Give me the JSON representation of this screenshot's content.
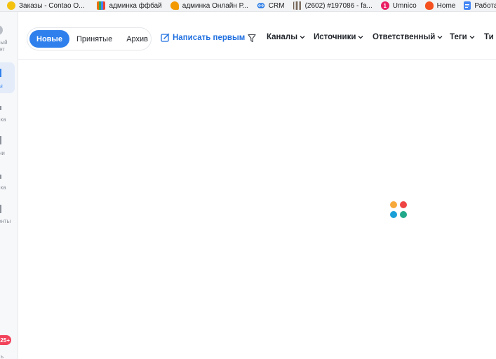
{
  "bookmarks": [
    {
      "label": "Заказы - Contao O...",
      "icon": "contao-icon",
      "color": "#f4b400"
    },
    {
      "label": "админка ффбай",
      "icon": "apps-grid-icon",
      "color": "#e8710a"
    },
    {
      "label": "админка Онлайн Р...",
      "icon": "pizza-icon",
      "color": "#f29900"
    },
    {
      "label": "CRM",
      "icon": "crm-link-icon",
      "color": "#1a73e8"
    },
    {
      "label": "(2602) #197086 - fa...",
      "icon": "barcode-icon",
      "color": "#7a6a5a"
    },
    {
      "label": "Umnico",
      "icon": "umnico-icon",
      "color": "#e91e63",
      "badge": "1"
    },
    {
      "label": "Home",
      "icon": "home-icon",
      "color": "#f4511e"
    },
    {
      "label": "Работа в б",
      "icon": "docs-icon",
      "color": "#4285f4"
    }
  ],
  "sidebar": {
    "profile_line1": "ный",
    "profile_line2": "ет",
    "items": [
      {
        "label": "ы"
      },
      {
        "label": "ика"
      },
      {
        "label": "ни"
      },
      {
        "label": "ика"
      },
      {
        "label": "енты"
      }
    ],
    "badge": "25+",
    "bottom_label": "ь"
  },
  "toolbar": {
    "tabs": [
      {
        "label": "Новые",
        "active": true
      },
      {
        "label": "Принятые",
        "active": false
      },
      {
        "label": "Архив",
        "active": false
      }
    ],
    "write_first": "Написать первым",
    "filters": [
      {
        "label": "Каналы"
      },
      {
        "label": "Источники"
      },
      {
        "label": "Ответственный"
      },
      {
        "label": "Теги"
      },
      {
        "label": "Ти"
      }
    ]
  },
  "loader": {
    "colors": [
      "#f7a93b",
      "#ef4444",
      "#1a9fd6",
      "#20a88a"
    ]
  },
  "colors": {
    "accent": "#2f80ed",
    "link": "#1f6fe0"
  }
}
